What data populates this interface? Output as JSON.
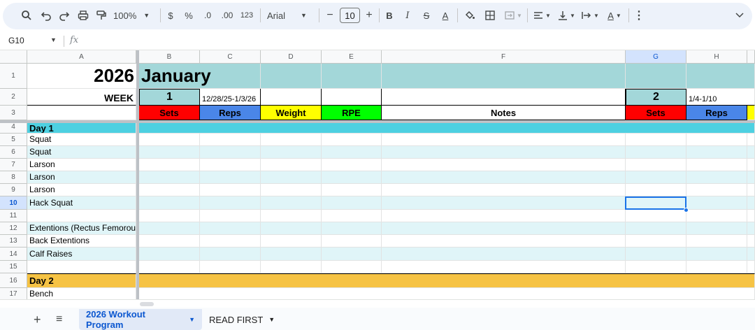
{
  "toolbar": {
    "zoom": "100%",
    "currency_label": "$",
    "percent_label": "%",
    "decrease_decimal_label": ".0",
    "increase_decimal_label": ".00",
    "number_format_label": "123",
    "font_name": "Arial",
    "font_size": "10",
    "minus_label": "−",
    "plus_label": "+",
    "bold_label": "B",
    "italic_label": "I",
    "strike_label": "S",
    "text_color_label": "A",
    "more_label": "⋮",
    "collapse_label": "⌄"
  },
  "formula_bar": {
    "name_box": "G10",
    "fx_label": "fx"
  },
  "columns": [
    "A",
    "B",
    "C",
    "D",
    "E",
    "F",
    "G",
    "H"
  ],
  "rows": [
    "1",
    "2",
    "3",
    "4",
    "5",
    "6",
    "7",
    "8",
    "9",
    "10",
    "11",
    "12",
    "13",
    "14",
    "15",
    "16",
    "17"
  ],
  "cells": {
    "a1": "2026",
    "b1": "January",
    "a2": "WEEK",
    "b2": "1",
    "c2": "12/28/25-1/3/26",
    "g2": "2",
    "h2": "1/4-1/10",
    "b3": "Sets",
    "c3": "Reps",
    "d3": "Weight",
    "e3": "RPE",
    "f3": "Notes",
    "g3": "Sets",
    "h3": "Reps",
    "a4": "Day 1",
    "a5": "Squat",
    "a6": "Squat",
    "a7": "Larson",
    "a8": "Larson",
    "a9": "Larson",
    "a10": "Hack Squat",
    "a12": "Extentions (Rectus Femorous)",
    "a13": "Back Extentions",
    "a14": "Calf Raises",
    "a16": "Day 2",
    "a17": "Bench"
  },
  "sheets": {
    "add_label": "+",
    "list_label": "≡",
    "tab1": "2026 Workout Program",
    "tab2": "READ FIRST"
  },
  "colors": {
    "teal": "#a3d7d9",
    "sets_red": "#ff0000",
    "reps_blue": "#4a86e8",
    "weight_yellow": "#ffff00",
    "rpe_green": "#00ff00",
    "day1_cyan": "#4dd0e1",
    "day2_gold": "#f6c344",
    "band_light": "#e0f5f8"
  }
}
